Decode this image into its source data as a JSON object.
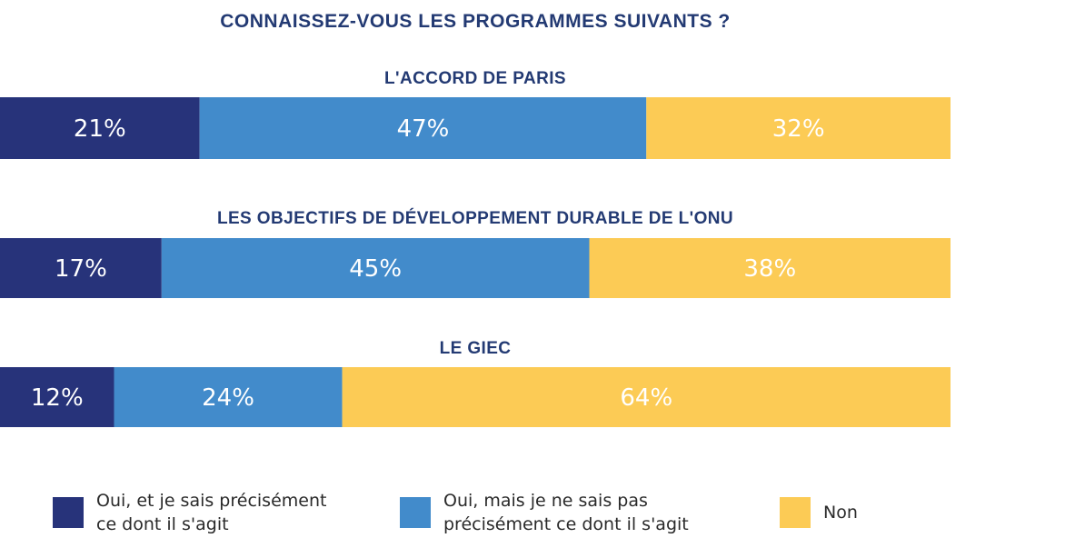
{
  "chart_data": {
    "type": "bar",
    "orientation": "horizontal-stacked-100",
    "title": "CONNAISSEZ-VOUS LES PROGRAMMES SUIVANTS ?",
    "categories": [
      "L'ACCORD DE PARIS",
      "LES OBJECTIFS DE DÉVELOPPEMENT DURABLE DE L'ONU",
      "LE GIEC"
    ],
    "series": [
      {
        "name": "Oui, et je sais précisément\nce dont il s'agit",
        "color": "#27337a",
        "values": [
          21,
          17,
          12
        ]
      },
      {
        "name": "Oui, mais je ne sais pas\nprécisément ce dont il s'agit",
        "color": "#428bcb",
        "values": [
          47,
          45,
          24
        ]
      },
      {
        "name": "Non",
        "color": "#fccb55",
        "values": [
          32,
          38,
          64
        ]
      }
    ],
    "value_suffix": "%",
    "xlim": [
      0,
      100
    ],
    "legend_position": "bottom"
  }
}
